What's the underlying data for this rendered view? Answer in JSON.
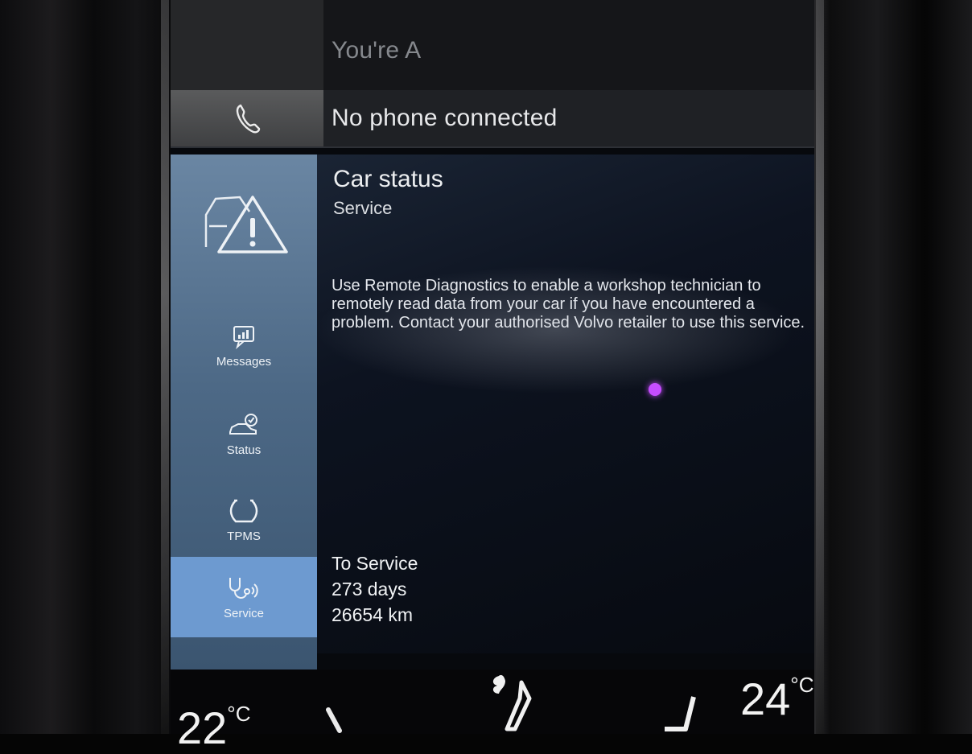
{
  "top_row": {
    "text": "You're A"
  },
  "phone_row": {
    "icon": "phone-icon",
    "text": "No phone connected"
  },
  "sidebar": {
    "header_icon": "car-warning-icon",
    "items": [
      {
        "label": "Messages",
        "icon": "messages-icon",
        "active": false
      },
      {
        "label": "Status",
        "icon": "car-status-icon",
        "active": false
      },
      {
        "label": "TPMS",
        "icon": "tpms-icon",
        "active": false
      },
      {
        "label": "Service",
        "icon": "stethoscope-icon",
        "active": true
      }
    ]
  },
  "content": {
    "title": "Car status",
    "subtitle": "Service",
    "description": "Use Remote Diagnostics to enable a workshop technician to remotely read data from your car if you have encountered a problem. Contact your authorised Volvo retailer to use this service.",
    "to_service_label": "To Service",
    "days": "273 days",
    "km": "26654 km"
  },
  "climate": {
    "left_temp": "22",
    "right_temp": "24",
    "unit": "°C",
    "fan_icon": "fan-icon",
    "seat_icon": "seat-heat-icon"
  },
  "colors": {
    "sidebar_top": "#6a86a3",
    "sidebar_active": "#6d9ad0",
    "indicator_dot": "#c64dff"
  }
}
